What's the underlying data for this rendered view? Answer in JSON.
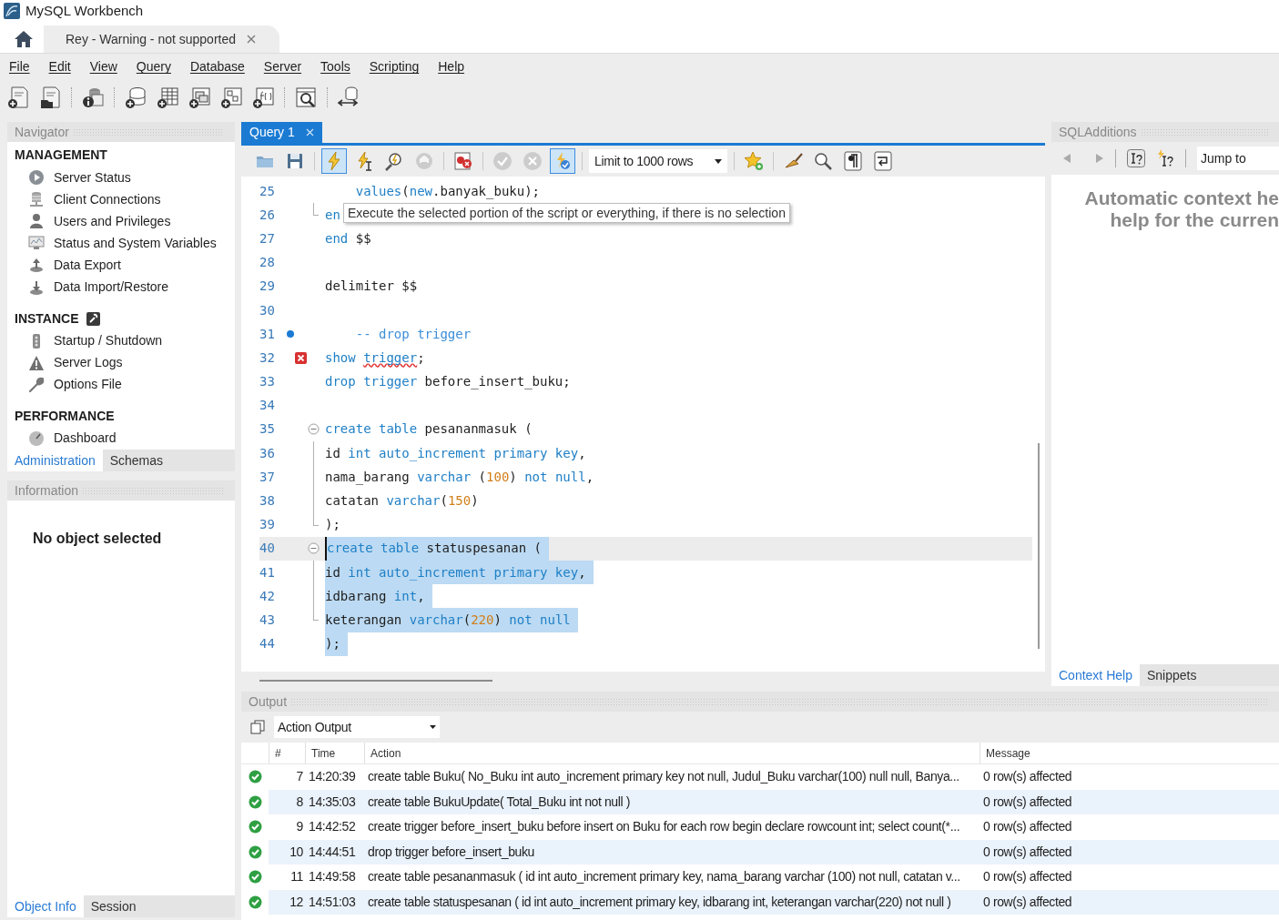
{
  "window": {
    "title": "MySQL Workbench"
  },
  "connection_tabs": [
    {
      "label": "Rey - Warning - not supported",
      "selected": true
    }
  ],
  "menu": [
    "File",
    "Edit",
    "View",
    "Query",
    "Database",
    "Server",
    "Tools",
    "Scripting",
    "Help"
  ],
  "navigator": {
    "title": "Navigator",
    "sections": [
      {
        "heading": "MANAGEMENT",
        "items": [
          "Server Status",
          "Client Connections",
          "Users and Privileges",
          "Status and System Variables",
          "Data Export",
          "Data Import/Restore"
        ]
      },
      {
        "heading": "INSTANCE",
        "items": [
          "Startup / Shutdown",
          "Server Logs",
          "Options File"
        ]
      },
      {
        "heading": "PERFORMANCE",
        "items": [
          "Dashboard"
        ]
      }
    ],
    "tabs": [
      {
        "label": "Administration",
        "selected": true
      },
      {
        "label": "Schemas",
        "selected": false
      }
    ]
  },
  "information": {
    "title": "Information",
    "message": "No object selected",
    "tabs": [
      {
        "label": "Object Info",
        "selected": true
      },
      {
        "label": "Session",
        "selected": false
      }
    ]
  },
  "query_tabs": [
    {
      "label": "Query 1",
      "selected": true
    }
  ],
  "editor_toolbar": {
    "execute_hovered": true,
    "autocommit_on": true,
    "limit": "Limit to 1000 rows"
  },
  "tooltip": "Execute the selected portion of the script or everything, if there is no selection",
  "editor": {
    "lines": [
      {
        "no": "25",
        "selected": false,
        "current": false,
        "bookmark": false,
        "error": false,
        "fold_start": false,
        "fold_line": false,
        "fold_end": false,
        "tokens": [
          {
            "kind": "kw",
            "text": "    values"
          },
          {
            "kind": "plain",
            "text": "("
          },
          {
            "kind": "kw",
            "text": "new"
          },
          {
            "kind": "plain",
            "text": ".banyak_buku);"
          }
        ]
      },
      {
        "no": "26",
        "selected": false,
        "current": false,
        "bookmark": false,
        "error": false,
        "fold_start": false,
        "fold_line": false,
        "fold_end": true,
        "tokens": [
          {
            "kind": "kw",
            "text": "en"
          }
        ]
      },
      {
        "no": "27",
        "selected": false,
        "current": false,
        "bookmark": false,
        "error": false,
        "fold_start": false,
        "fold_line": false,
        "fold_end": false,
        "tokens": [
          {
            "kind": "kw",
            "text": "end"
          },
          {
            "kind": "plain",
            "text": " $$"
          }
        ]
      },
      {
        "no": "28",
        "selected": false,
        "current": false,
        "bookmark": false,
        "error": false,
        "fold_start": false,
        "fold_line": false,
        "fold_end": false
      },
      {
        "no": "29",
        "selected": false,
        "current": false,
        "bookmark": false,
        "error": false,
        "fold_start": false,
        "fold_line": false,
        "fold_end": false,
        "tokens": [
          {
            "kind": "plain",
            "text": "delimiter $$"
          }
        ]
      },
      {
        "no": "30",
        "selected": false,
        "current": false,
        "bookmark": false,
        "error": false,
        "fold_start": false,
        "fold_line": false,
        "fold_end": false
      },
      {
        "no": "31",
        "selected": false,
        "current": false,
        "bookmark": true,
        "error": false,
        "fold_start": false,
        "fold_line": false,
        "fold_end": false,
        "tokens": [
          {
            "kind": "comment",
            "text": "    -- drop trigger"
          }
        ]
      },
      {
        "no": "32",
        "selected": false,
        "current": false,
        "bookmark": false,
        "error": true,
        "fold_start": false,
        "fold_line": false,
        "fold_end": false,
        "tokens": [
          {
            "kind": "kw",
            "text": "show "
          },
          {
            "kind": "misspelled",
            "text": "trigger"
          },
          {
            "kind": "plain",
            "text": ";"
          }
        ]
      },
      {
        "no": "33",
        "selected": false,
        "current": false,
        "bookmark": false,
        "error": false,
        "fold_start": false,
        "fold_line": false,
        "fold_end": false,
        "tokens": [
          {
            "kind": "kw",
            "text": "drop trigger"
          },
          {
            "kind": "plain",
            "text": " before_insert_buku;"
          }
        ]
      },
      {
        "no": "34",
        "selected": false,
        "current": false,
        "bookmark": false,
        "error": false,
        "fold_start": false,
        "fold_line": false,
        "fold_end": false
      },
      {
        "no": "35",
        "selected": false,
        "current": false,
        "bookmark": false,
        "error": false,
        "fold_start": true,
        "fold_line": false,
        "fold_end": false,
        "tokens": [
          {
            "kind": "kw",
            "text": "create table"
          },
          {
            "kind": "plain",
            "text": " pesananmasuk ("
          }
        ]
      },
      {
        "no": "36",
        "selected": false,
        "current": false,
        "bookmark": false,
        "error": false,
        "fold_start": false,
        "fold_line": true,
        "fold_end": false,
        "tokens": [
          {
            "kind": "plain",
            "text": "id "
          },
          {
            "kind": "kw",
            "text": "int auto_increment primary key"
          },
          {
            "kind": "plain",
            "text": ","
          }
        ]
      },
      {
        "no": "37",
        "selected": false,
        "current": false,
        "bookmark": false,
        "error": false,
        "fold_start": false,
        "fold_line": true,
        "fold_end": false,
        "tokens": [
          {
            "kind": "plain",
            "text": "nama_barang "
          },
          {
            "kind": "kw",
            "text": "varchar"
          },
          {
            "kind": "plain",
            "text": " ("
          },
          {
            "kind": "num",
            "text": "100"
          },
          {
            "kind": "plain",
            "text": ") "
          },
          {
            "kind": "kw",
            "text": "not null"
          },
          {
            "kind": "plain",
            "text": ","
          }
        ]
      },
      {
        "no": "38",
        "selected": false,
        "current": false,
        "bookmark": false,
        "error": false,
        "fold_start": false,
        "fold_line": true,
        "fold_end": false,
        "tokens": [
          {
            "kind": "plain",
            "text": "catatan "
          },
          {
            "kind": "kw",
            "text": "varchar"
          },
          {
            "kind": "plain",
            "text": "("
          },
          {
            "kind": "num",
            "text": "150"
          },
          {
            "kind": "plain",
            "text": ")"
          }
        ]
      },
      {
        "no": "39",
        "selected": false,
        "current": false,
        "bookmark": false,
        "error": false,
        "fold_start": false,
        "fold_line": false,
        "fold_end": true,
        "tokens": [
          {
            "kind": "plain",
            "text": ");"
          }
        ]
      },
      {
        "no": "40",
        "selected": true,
        "current": true,
        "bookmark": false,
        "error": false,
        "fold_start": true,
        "fold_line": false,
        "fold_end": false,
        "tokens": [
          {
            "kind": "kw",
            "text": "create table"
          },
          {
            "kind": "plain",
            "text": " statuspesanan ("
          }
        ]
      },
      {
        "no": "41",
        "selected": true,
        "current": false,
        "bookmark": false,
        "error": false,
        "fold_start": false,
        "fold_line": true,
        "fold_end": false,
        "tokens": [
          {
            "kind": "plain",
            "text": "id "
          },
          {
            "kind": "kw",
            "text": "int auto_increment primary key"
          },
          {
            "kind": "plain",
            "text": ","
          }
        ]
      },
      {
        "no": "42",
        "selected": true,
        "current": false,
        "bookmark": false,
        "error": false,
        "fold_start": false,
        "fold_line": true,
        "fold_end": false,
        "tokens": [
          {
            "kind": "plain",
            "text": "idbarang "
          },
          {
            "kind": "kw",
            "text": "int"
          },
          {
            "kind": "plain",
            "text": ","
          }
        ]
      },
      {
        "no": "43",
        "selected": true,
        "current": false,
        "bookmark": false,
        "error": false,
        "fold_start": false,
        "fold_line": false,
        "fold_end": true,
        "tokens": [
          {
            "kind": "plain",
            "text": "keterangan "
          },
          {
            "kind": "kw",
            "text": "varchar"
          },
          {
            "kind": "plain",
            "text": "("
          },
          {
            "kind": "num",
            "text": "220"
          },
          {
            "kind": "plain",
            "text": ") "
          },
          {
            "kind": "kw",
            "text": "not null"
          }
        ]
      },
      {
        "no": "44",
        "selected": true,
        "current": false,
        "bookmark": false,
        "error": false,
        "fold_start": false,
        "fold_line": false,
        "fold_end": false,
        "tokens": [
          {
            "kind": "plain",
            "text": ");"
          }
        ]
      }
    ]
  },
  "sql_additions": {
    "title": "SQLAdditions",
    "jump_to": "Jump to",
    "help_lines": [
      "Automatic context he",
      "help for the curren"
    ],
    "tabs": [
      {
        "label": "Context Help",
        "selected": true
      },
      {
        "label": "Snippets",
        "selected": false
      }
    ]
  },
  "output": {
    "title": "Output",
    "mode": "Action Output",
    "columns": [
      "#",
      "Time",
      "Action",
      "Message"
    ],
    "rows": [
      {
        "succeeded": true,
        "no": "7",
        "time": "14:20:39",
        "action": "create table Buku( No_Buku int auto_increment primary key not null, Judul_Buku varchar(100) null null, Banya...",
        "message": "0 row(s) affected"
      },
      {
        "succeeded": true,
        "no": "8",
        "time": "14:35:03",
        "action": "create table BukuUpdate( Total_Buku int not null )",
        "message": "0 row(s) affected"
      },
      {
        "succeeded": true,
        "no": "9",
        "time": "14:42:52",
        "action": "create trigger before_insert_buku before insert on Buku for each row begin declare rowcount int; select count(*...",
        "message": "0 row(s) affected"
      },
      {
        "succeeded": true,
        "no": "10",
        "time": "14:44:51",
        "action": "drop trigger before_insert_buku",
        "message": "0 row(s) affected"
      },
      {
        "succeeded": true,
        "no": "11",
        "time": "14:49:58",
        "action": "create table pesananmasuk ( id int auto_increment primary key, nama_barang varchar (100) not null, catatan v...",
        "message": "0 row(s) affected"
      },
      {
        "succeeded": true,
        "no": "12",
        "time": "14:51:03",
        "action": "create table statuspesanan ( id int auto_increment primary key, idbarang int, keterangan varchar(220) not null )",
        "message": "0 row(s) affected"
      }
    ]
  }
}
